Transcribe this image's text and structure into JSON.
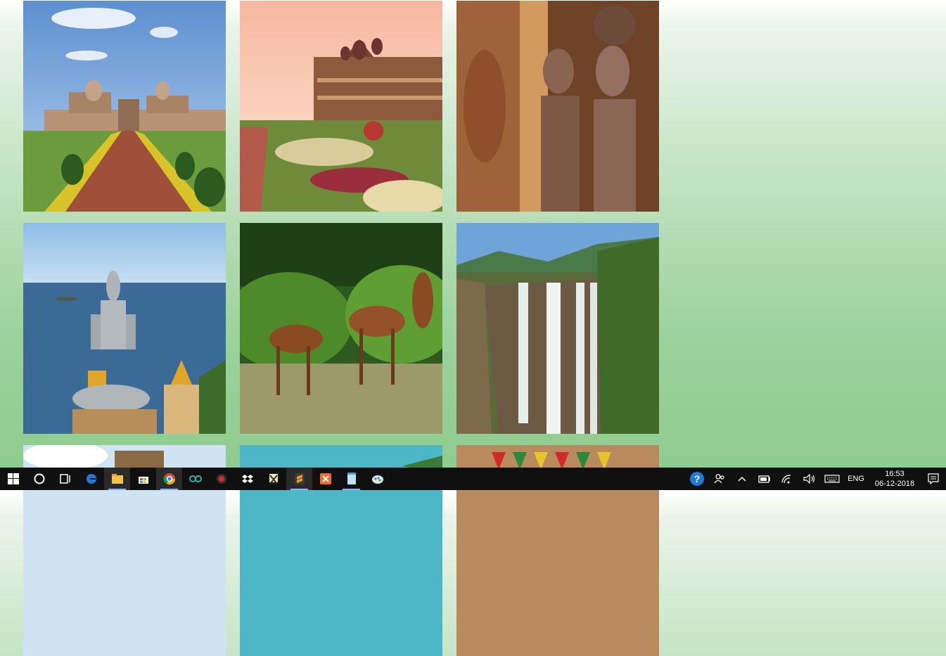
{
  "gallery": {
    "tiles": [
      {
        "name": "gol-gumbaz-mosque-photo",
        "alt": "Mosque with garden path"
      },
      {
        "name": "mysore-palace-photo",
        "alt": "Palace with gardens"
      },
      {
        "name": "temple-carvings-photo",
        "alt": "Stone temple carvings"
      },
      {
        "name": "shiva-statue-photo",
        "alt": "Shiva statue by the sea"
      },
      {
        "name": "spotted-deer-photo",
        "alt": "Spotted deer sparring"
      },
      {
        "name": "jog-falls-photo",
        "alt": "Waterfall in a gorge"
      },
      {
        "name": "hill-fort-photo",
        "alt": "Hill fort under sky"
      },
      {
        "name": "coastal-hills-photo",
        "alt": "Coastal hills"
      },
      {
        "name": "decorated-textile-photo",
        "alt": "Colorful decoration"
      }
    ]
  },
  "taskbar": {
    "apps": [
      {
        "name": "start-button",
        "icon": "windows-icon"
      },
      {
        "name": "search-button",
        "icon": "cortana-circle-icon"
      },
      {
        "name": "task-view-button",
        "icon": "task-view-icon"
      },
      {
        "name": "edge-app",
        "icon": "edge-icon"
      },
      {
        "name": "file-explorer-app",
        "icon": "folder-icon"
      },
      {
        "name": "store-app",
        "icon": "store-bag-icon"
      },
      {
        "name": "chrome-app",
        "icon": "chrome-icon"
      },
      {
        "name": "arduino-app",
        "icon": "infinity-icon"
      },
      {
        "name": "record-app",
        "icon": "record-icon"
      },
      {
        "name": "dropbox-app",
        "icon": "dropbox-icon"
      },
      {
        "name": "snipping-tool-app",
        "icon": "scissors-icon"
      },
      {
        "name": "sublime-text-app",
        "icon": "sublime-icon"
      },
      {
        "name": "xampp-app",
        "icon": "xampp-icon"
      },
      {
        "name": "notepad-app",
        "icon": "notepad-icon"
      },
      {
        "name": "paint-app",
        "icon": "paint-icon"
      }
    ],
    "tray": {
      "language": "ENG",
      "time": "16:53",
      "date": "06-12-2018"
    }
  },
  "colors": {
    "taskbar_bg": "#101010",
    "background_top": "#ffffff",
    "background_bottom": "#8fcc8f"
  }
}
